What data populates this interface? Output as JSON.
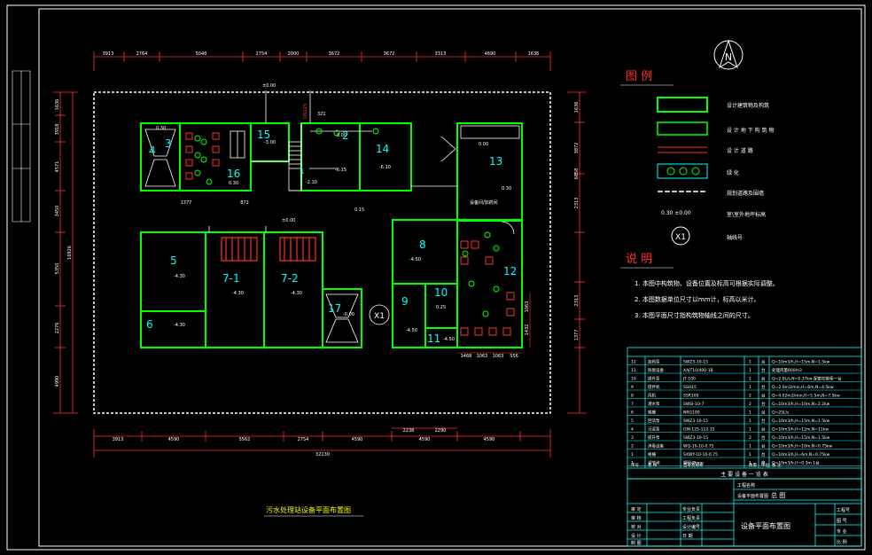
{
  "north_symbol": "N",
  "dims_top": [
    "3913",
    "2764",
    "5048",
    "2754",
    "2000",
    "3672",
    "3672",
    "3313",
    "4690",
    "1636"
  ],
  "dims_bottom": [
    "3913",
    "4590",
    "5562",
    "2754",
    "4590",
    "4590",
    "4590"
  ],
  "dims_bottom_pair": [
    "2238",
    "2290"
  ],
  "dim_total": "32130",
  "dims_left": [
    "1636",
    "3918",
    "4571",
    "3450",
    "5350",
    "2276",
    "4990"
  ],
  "total_left": "16926",
  "dims_right": [
    "1636",
    "3872",
    "6858",
    "2313",
    "2313",
    "1377"
  ],
  "dims_room12": [
    "1468",
    "1063",
    "1063",
    "556"
  ],
  "dims_room12_right": [
    "1063",
    "1432"
  ],
  "dims_room3": [
    "1377",
    "872"
  ],
  "elev_marks": [
    "±0.00",
    "±0.00",
    "-3.00",
    "-3.00",
    "0.30",
    "0.15",
    "-4.50",
    "-4.50",
    "-4.50",
    "-6.10",
    "-6.15",
    "-2.10",
    "0.30",
    "0.30",
    "-4.30",
    "-4.30",
    "-4.30",
    "-4.30",
    "-0.00",
    "0.00",
    "321",
    "0.25"
  ],
  "section_label": "DN125",
  "room_labels": [
    "3",
    "4",
    "15",
    "16",
    "2",
    "1",
    "14",
    "13",
    "5",
    "6",
    "7-1",
    "7-2",
    "17",
    "8",
    "9",
    "10",
    "11",
    "12"
  ],
  "room_text": {
    "r1_sub": "1",
    "r12_mark": "设备间/加药间"
  },
  "axis_marker": "X1",
  "legend": {
    "title": "图  例",
    "items": [
      "设计建筑物及构筑",
      "设 计 地 下 构 筑 物",
      "设 计 道 路",
      "绿      化",
      "规划道路及围墙",
      "室\\室外地坪标高",
      "轴线号"
    ],
    "elev_sample": "0.30  ±0.00"
  },
  "notes": {
    "title": "说  明",
    "lines": [
      "1. 本图中构筑物、设备位置及标高可根据实际调整。",
      "2. 本图数据单位尺寸以mm计，标高以米计。",
      "3. 本图平面尺寸指构筑物轴线之间的尺寸。"
    ]
  },
  "equipment_rows": [
    [
      "12",
      "加药泵",
      "SWZ3-10-15",
      "1",
      "台",
      "Q=10m3/h,H=15m,N=1.5kw"
    ],
    [
      "11",
      "除臭设备",
      "XAJT10/400-1B",
      "1",
      "台",
      "处理风量800m3"
    ],
    [
      "10",
      "提升泵",
      "JT-100",
      "1",
      "台",
      "Q=2.0L/s,N=0.37kw  配套控制柜一台"
    ],
    [
      "9",
      "搅拌机",
      "SSH15",
      "1",
      "台",
      "Q=2.0m3/min,H=6m,N=4.5kw"
    ],
    [
      "8",
      "风机",
      "SSR100",
      "2",
      "台",
      "Q=4.02m3/min,H=5.5m,N=7.5kw"
    ],
    [
      "7",
      "潜水泵",
      "SWSI-10-7",
      "2",
      "台",
      "Q=10m3/h,H=10m,N=2.2kw"
    ],
    [
      "6",
      "格栅",
      "NRG100",
      "1",
      "台",
      "Q=25L/s"
    ],
    [
      "5",
      "回流泵",
      "SWZ3-10-15",
      "1",
      "台",
      "Q=10m3/h,H=15m,N=1.5kw"
    ],
    [
      "4",
      "污泥泵",
      "GW-125-112-15",
      "1",
      "台",
      "Q=10m3/h,H=12m,N=11kw"
    ],
    [
      "3",
      "提升泵",
      "SWZ3-10-15",
      "2",
      "台",
      "Q=10m3/h,H=15m,N=1.5kw"
    ],
    [
      "2",
      "消毒设备",
      "WQ-10-10-0.75",
      "1",
      "台",
      "Q=10m3/h,H=10m,N=0.75kw"
    ],
    [
      "1",
      "格栅",
      "SXWY-10-10-0.75",
      "1",
      "台",
      "Q=10m3/h,H=6m,N=0.75kw"
    ],
    [
      "1",
      "调节池",
      "钢砼/Ømm",
      "1",
      "座",
      "Q=10m3/h,H=0.3m 1台"
    ]
  ],
  "table_header": [
    "序号",
    "名 称",
    "型号及规格",
    "数量",
    "单位",
    "备 注"
  ],
  "table_caption": "主 要 设 备 一 览 表",
  "title_block": {
    "project": "工程名称",
    "project_value": "总  图",
    "drawing_name": "设备平面布置图",
    "left_labels": [
      "审 定",
      "审 核",
      "校 对",
      "设 计",
      "制 图"
    ],
    "mid_labels": [
      "专业负责",
      "工程负责",
      "设计编号",
      "日 期"
    ],
    "right_labels": [
      "工程号",
      "图 号",
      "专 业",
      "比 例"
    ]
  },
  "drawing_caption": "污水处理站设备平面布置图"
}
